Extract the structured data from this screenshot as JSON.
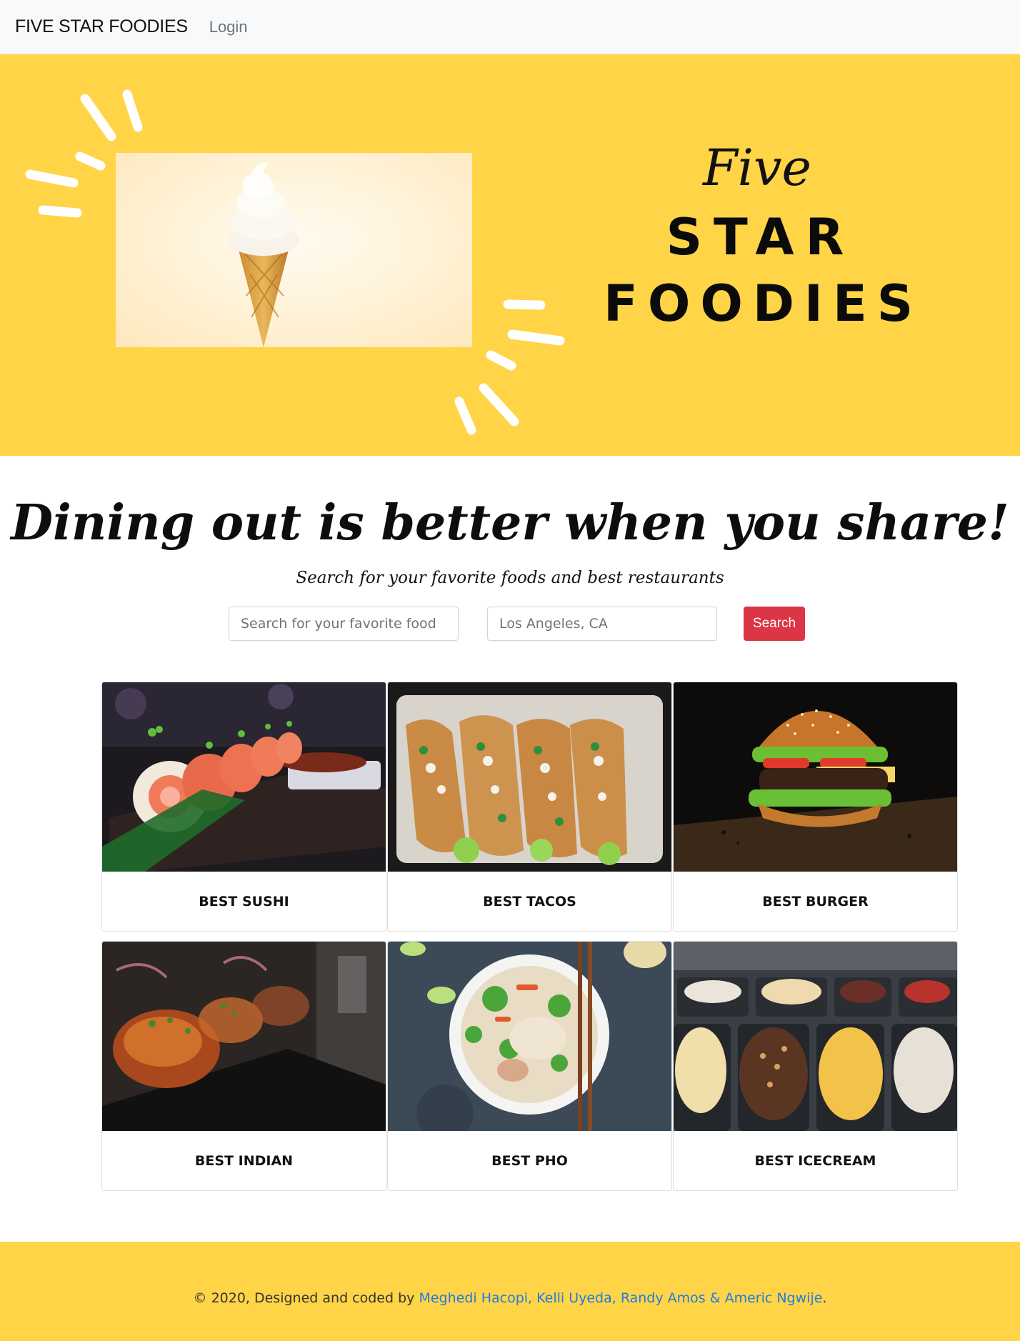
{
  "navbar": {
    "brand": "FIVE STAR FOODIES",
    "login": "Login"
  },
  "hero": {
    "title_line1": "Five",
    "title_line2": "STAR",
    "title_line3": "FOODIES",
    "image_subject": "soft-serve ice cream cone",
    "background_color": "#ffd447"
  },
  "main": {
    "tagline": "Dining out is better when you share!",
    "subline": "Search for your favorite foods and best restaurants"
  },
  "search": {
    "food_placeholder": "Search for your favorite food",
    "location_placeholder": "Los Angeles, CA",
    "button_label": "Search",
    "button_color": "#dc3545"
  },
  "cards": [
    {
      "title": "BEST SUSHI"
    },
    {
      "title": "BEST TACOS"
    },
    {
      "title": "BEST BURGER"
    },
    {
      "title": "BEST INDIAN"
    },
    {
      "title": "BEST PHO"
    },
    {
      "title": "BEST ICECREAM"
    }
  ],
  "footer": {
    "prefix": "© 2020, Designed and coded by ",
    "credits": "Meghedi Hacopi, Kelli Uyeda, Randy Amos & Americ Ngwije",
    "suffix": ".",
    "link_color": "#1f7be3"
  }
}
